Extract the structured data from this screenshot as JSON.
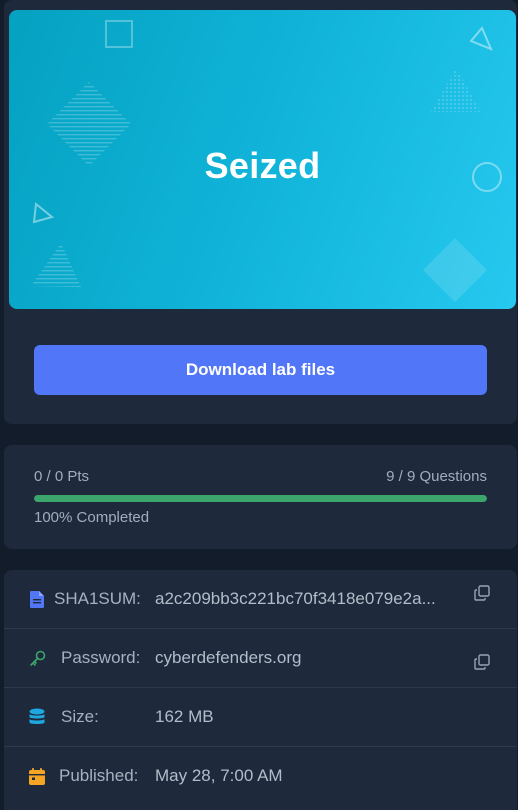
{
  "banner": {
    "title": "Seized"
  },
  "actions": {
    "download_label": "Download lab files"
  },
  "progress": {
    "points": "0 / 0 Pts",
    "questions": "9 / 9 Questions",
    "completed_label": "100% Completed",
    "completed_fraction": 1.0,
    "bar_color": "#3ba56b"
  },
  "details": {
    "sha1": {
      "label": "SHA1SUM:",
      "value": "a2c209bb3c221bc70f3418e079e2a...",
      "icon": "file-icon",
      "icon_color": "#5176f8"
    },
    "password": {
      "label": "Password:",
      "value": "cyberdefenders.org",
      "icon": "key-icon",
      "icon_color": "#3ba56b"
    },
    "size": {
      "label": "Size:",
      "value": "162 MB",
      "icon": "database-icon",
      "icon_color": "#1ea7e0"
    },
    "published": {
      "label": "Published:",
      "value": "May 28, 7:00 AM",
      "icon": "calendar-icon",
      "icon_color": "#f5a524"
    }
  },
  "colors": {
    "accent": "#5176f8",
    "banner_start": "#05a1c1",
    "banner_end": "#26c8ef"
  }
}
